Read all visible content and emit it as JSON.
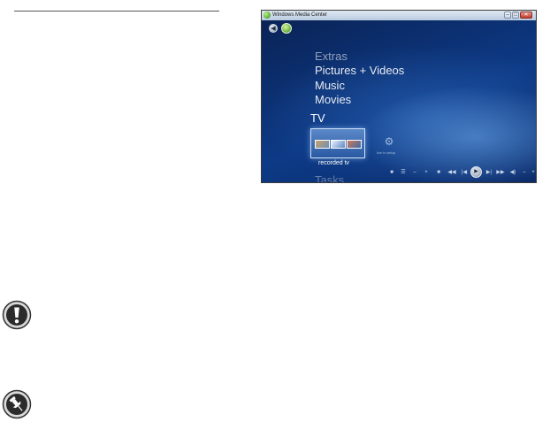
{
  "window": {
    "title": "Windows Media Center",
    "controls": {
      "minimize": "–",
      "maximize": "□",
      "close": "✕"
    }
  },
  "menu": {
    "items": [
      "Extras",
      "Pictures + Videos",
      "Music",
      "Movies",
      "TV",
      "Tasks"
    ]
  },
  "tv_strip": {
    "selected_label": "recorded tv",
    "secondary_label": "live tv setup"
  },
  "transport": {
    "glyphs": [
      "■",
      "☰",
      "–",
      "+",
      "■",
      "◀◀",
      "|◀",
      "▶",
      "▶|",
      "▶▶",
      "◀)",
      "–",
      "+"
    ]
  },
  "icons": {
    "warning": "exclamation-icon",
    "note": "pushpin-icon",
    "back": "back-arrow-icon",
    "logo": "media-center-logo-icon",
    "gear": "gear-icon"
  }
}
